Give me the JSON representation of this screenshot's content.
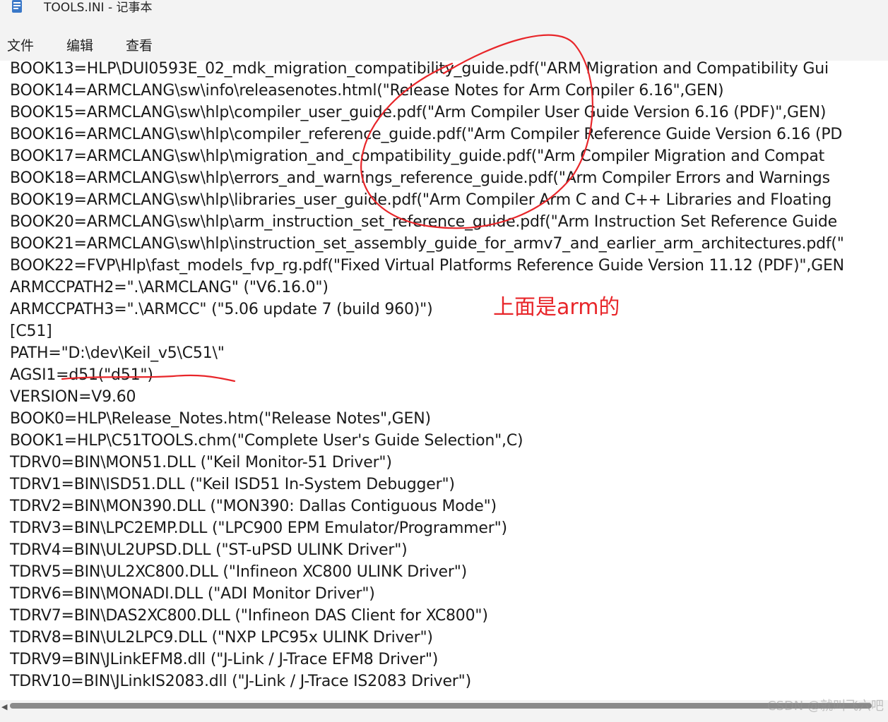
{
  "window": {
    "title": "TOOLS.INI - 记事本",
    "icon": "notepad-icon"
  },
  "menu": {
    "items": [
      "文件",
      "编辑",
      "查看"
    ]
  },
  "editor": {
    "lines": [
      "BOOK13=HLP\\DUI0593E_02_mdk_migration_compatibility_guide.pdf(\"ARM Migration and Compatibility Gui",
      "BOOK14=ARMCLANG\\sw\\info\\releasenotes.html(\"Release Notes for Arm Compiler 6.16\",GEN)",
      "BOOK15=ARMCLANG\\sw\\hlp\\compiler_user_guide.pdf(\"Arm Compiler User Guide Version 6.16 (PDF)\",GEN)",
      "BOOK16=ARMCLANG\\sw\\hlp\\compiler_reference_guide.pdf(\"Arm Compiler Reference Guide Version 6.16 (PD",
      "BOOK17=ARMCLANG\\sw\\hlp\\migration_and_compatibility_guide.pdf(\"Arm Compiler Migration and Compat",
      "BOOK18=ARMCLANG\\sw\\hlp\\errors_and_warnings_reference_guide.pdf(\"Arm Compiler Errors and Warnings",
      "BOOK19=ARMCLANG\\sw\\hlp\\libraries_user_guide.pdf(\"Arm Compiler Arm C and C++ Libraries and Floating",
      "BOOK20=ARMCLANG\\sw\\hlp\\arm_instruction_set_reference_guide.pdf(\"Arm Instruction Set Reference Guide",
      "BOOK21=ARMCLANG\\sw\\hlp\\instruction_set_assembly_guide_for_armv7_and_earlier_arm_architectures.pdf(\"",
      "BOOK22=FVP\\Hlp\\fast_models_fvp_rg.pdf(\"Fixed Virtual Platforms Reference Guide Version 11.12 (PDF)\",GEN",
      "ARMCCPATH2=\".\\ARMCLANG\" (\"V6.16.0\")",
      "ARMCCPATH3=\".\\ARMCC\" (\"5.06 update 7 (build 960)\")",
      "[C51]",
      "PATH=\"D:\\dev\\Keil_v5\\C51\\\"",
      "AGSI1=d51(\"d51\")",
      "VERSION=V9.60",
      "BOOK0=HLP\\Release_Notes.htm(\"Release Notes\",GEN)",
      "BOOK1=HLP\\C51TOOLS.chm(\"Complete User's Guide Selection\",C)",
      "TDRV0=BIN\\MON51.DLL (\"Keil Monitor-51 Driver\")",
      "TDRV1=BIN\\ISD51.DLL (\"Keil ISD51 In-System Debugger\")",
      "TDRV2=BIN\\MON390.DLL (\"MON390: Dallas Contiguous Mode\")",
      "TDRV3=BIN\\LPC2EMP.DLL (\"LPC900 EPM Emulator/Programmer\")",
      "TDRV4=BIN\\UL2UPSD.DLL (\"ST-uPSD ULINK Driver\")",
      "TDRV5=BIN\\UL2XC800.DLL (\"Infineon XC800 ULINK Driver\")",
      "TDRV6=BIN\\MONADI.DLL (\"ADI Monitor Driver\")",
      "TDRV7=BIN\\DAS2XC800.DLL (\"Infineon DAS Client for XC800\")",
      "TDRV8=BIN\\UL2LPC9.DLL (\"NXP LPC95x ULINK Driver\")",
      "TDRV9=BIN\\JLinkEFM8.dll (\"J-Link / J-Trace EFM8 Driver\")",
      "TDRV10=BIN\\JLinkIS2083.dll (\"J-Link / J-Trace IS2083 Driver\")"
    ]
  },
  "annotation": {
    "text": "上面是arm的",
    "color": "#e8262a"
  },
  "watermark": "CSDN @就叫飞六吧"
}
